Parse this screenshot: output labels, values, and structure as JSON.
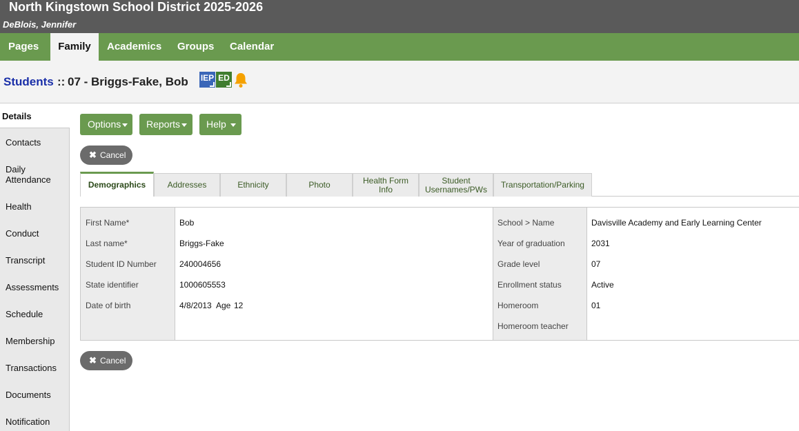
{
  "header": {
    "title": "North Kingstown School District 2025-2026",
    "user": "DeBlois, Jennifer"
  },
  "nav": {
    "pages": "Pages",
    "family": "Family",
    "academics": "Academics",
    "groups": "Groups",
    "calendar": "Calendar"
  },
  "crumb": {
    "students": "Students",
    "separator": "::",
    "student_name": "07 - Briggs-Fake, Bob"
  },
  "badges": {
    "iep": "IEP",
    "ed": "ED",
    "alert_icon": "bell-icon"
  },
  "sidebar": {
    "details": "Details",
    "contacts": "Contacts",
    "daily_attendance_1": "Daily",
    "daily_attendance_2": "Attendance",
    "health": "Health",
    "conduct": "Conduct",
    "transcript": "Transcript",
    "assessments": "Assessments",
    "schedule": "Schedule",
    "membership": "Membership",
    "transactions": "Transactions",
    "documents": "Documents",
    "notification": "Notification"
  },
  "toolbar": {
    "options": "Options",
    "reports": "Reports",
    "help": "Help",
    "cancel": "Cancel"
  },
  "tabs": {
    "demographics": "Demographics",
    "addresses": "Addresses",
    "ethnicity": "Ethnicity",
    "photo": "Photo",
    "health_form_1": "Health Form",
    "health_form_2": "Info",
    "usernames_1": "Student",
    "usernames_2": "Usernames/PWs",
    "transportation": "Transportation/Parking"
  },
  "left_fields": {
    "first_name_label": "First Name*",
    "first_name": "Bob",
    "last_name_label": "Last name*",
    "last_name": "Briggs-Fake",
    "student_id_label": "Student ID Number",
    "student_id": "240004656",
    "state_id_label": "State identifier",
    "state_id": "1000605553",
    "dob_label": "Date of birth",
    "dob": "4/8/2013",
    "age_label": "Age",
    "age": "12"
  },
  "right_fields": {
    "school_label": "School > Name",
    "school": "Davisville Academy and Early Learning Center",
    "grad_year_label": "Year of graduation",
    "grad_year": "2031",
    "grade_label": "Grade level",
    "grade": "07",
    "enrollment_label": "Enrollment status",
    "enrollment": "Active",
    "homeroom_label": "Homeroom",
    "homeroom": "01",
    "homeroom_teacher_label": "Homeroom teacher",
    "homeroom_teacher": ""
  },
  "colors": {
    "nav_green": "#6a9a4f",
    "header_gray": "#5a5a5a",
    "link_blue": "#1a2fa8",
    "iep_blue": "#3a66b8",
    "ed_green": "#3f7d2f",
    "bell_orange": "#f5a100"
  }
}
